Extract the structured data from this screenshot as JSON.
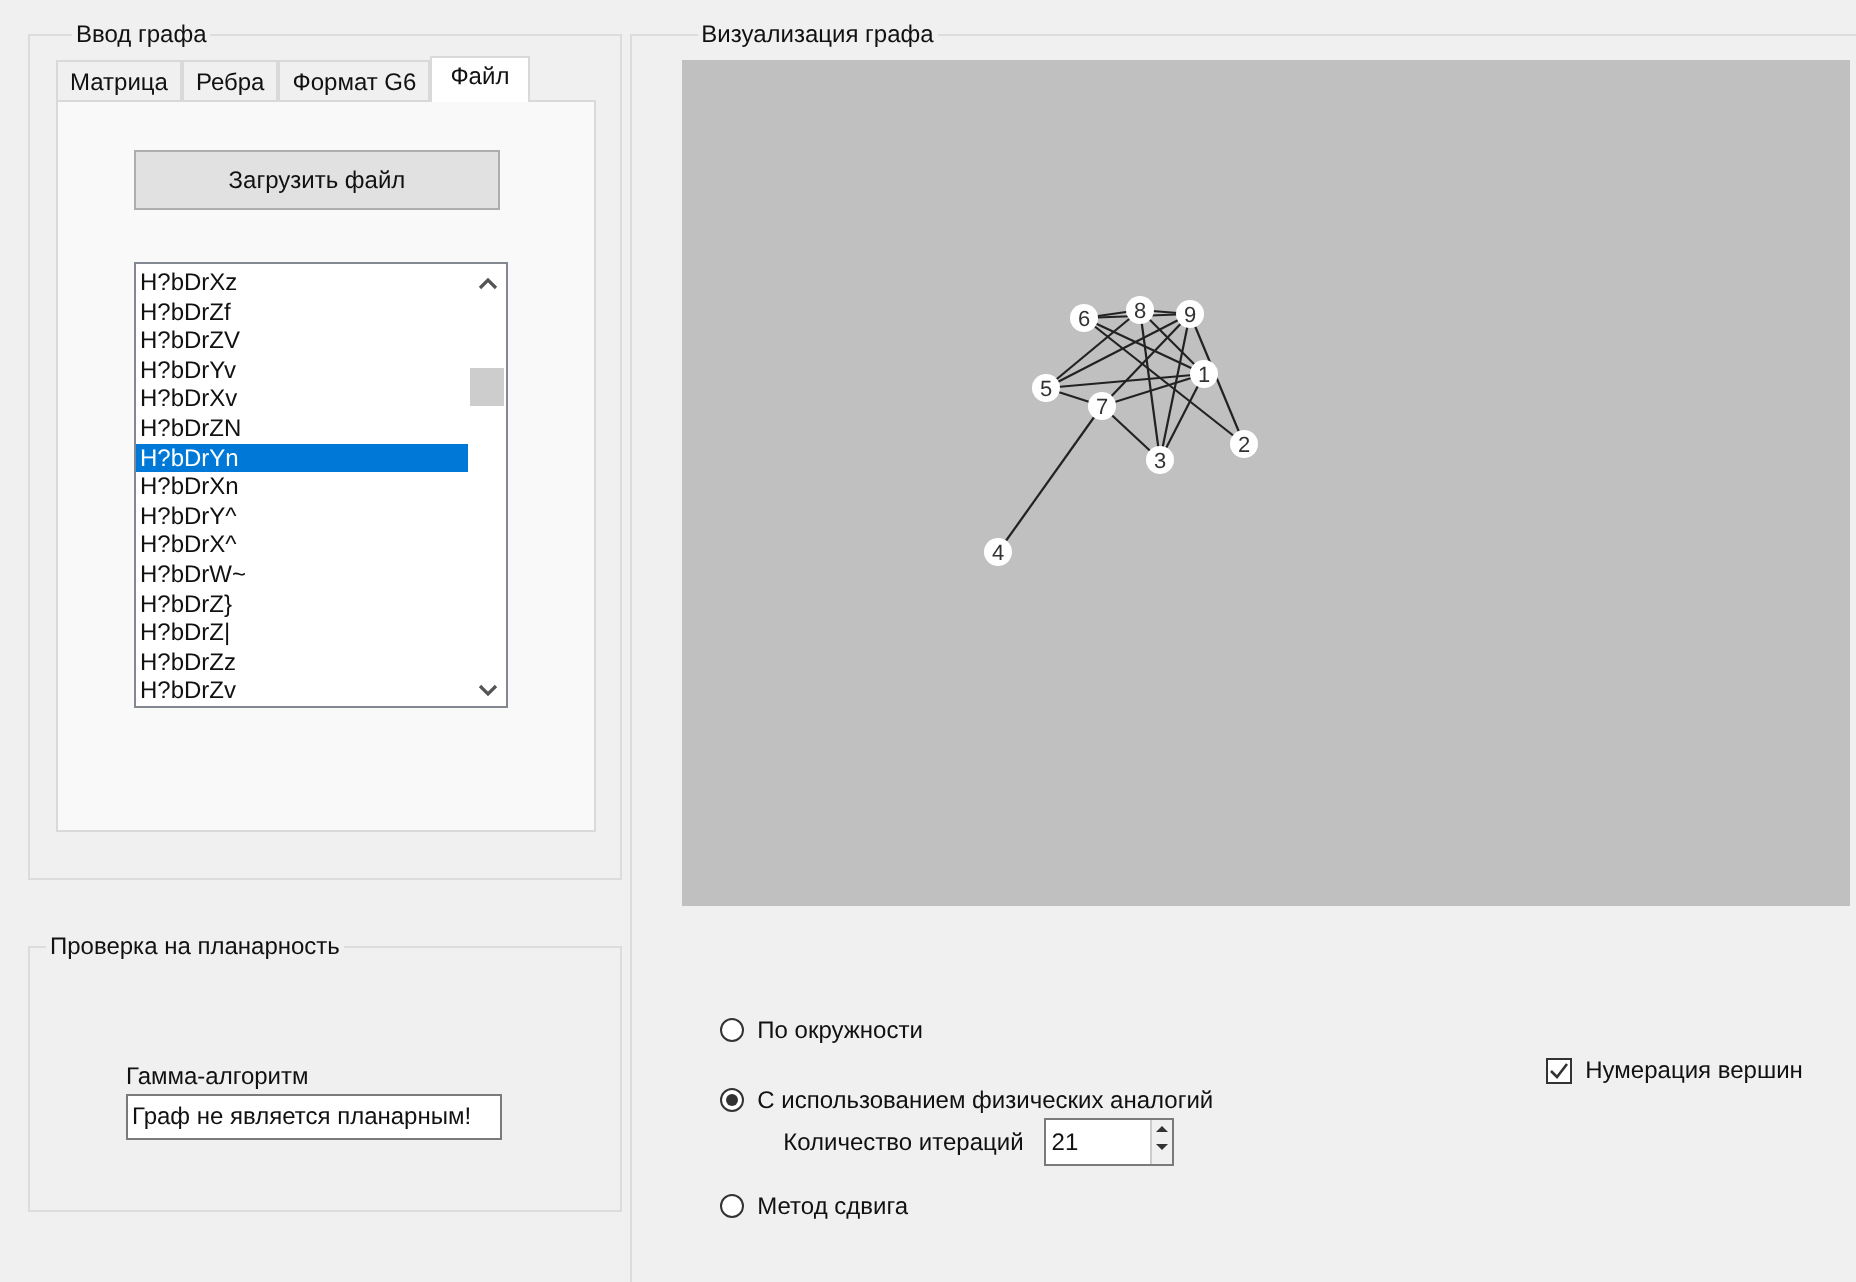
{
  "input_group": {
    "title": "Ввод графа",
    "tabs": [
      {
        "label": "Матрица",
        "selected": false
      },
      {
        "label": "Ребра",
        "selected": false
      },
      {
        "label": "Формат G6",
        "selected": false
      },
      {
        "label": "Файл",
        "selected": true
      }
    ],
    "load_button": "Загрузить файл",
    "file_list": [
      {
        "label": "H?bDrXz",
        "selected": false
      },
      {
        "label": "H?bDrZf",
        "selected": false
      },
      {
        "label": "H?bDrZV",
        "selected": false
      },
      {
        "label": "H?bDrYv",
        "selected": false
      },
      {
        "label": "H?bDrXv",
        "selected": false
      },
      {
        "label": "H?bDrZN",
        "selected": false
      },
      {
        "label": "H?bDrYn",
        "selected": true
      },
      {
        "label": "H?bDrXn",
        "selected": false
      },
      {
        "label": "H?bDrY^",
        "selected": false
      },
      {
        "label": "H?bDrX^",
        "selected": false
      },
      {
        "label": "H?bDrW~",
        "selected": false
      },
      {
        "label": "H?bDrZ}",
        "selected": false
      },
      {
        "label": "H?bDrZ|",
        "selected": false
      },
      {
        "label": "H?bDrZz",
        "selected": false
      },
      {
        "label": "H?bDrZv",
        "selected": false
      }
    ]
  },
  "planarity_group": {
    "title": "Проверка на планарность",
    "label": "Гамма-алгоритм",
    "result": "Граф не является планарным!"
  },
  "visualization_group": {
    "title": "Визуализация графа",
    "graph": {
      "nodes": [
        {
          "label": "1"
        },
        {
          "label": "2"
        },
        {
          "label": "3"
        },
        {
          "label": "4"
        },
        {
          "label": "5"
        },
        {
          "label": "6"
        },
        {
          "label": "7"
        },
        {
          "label": "8"
        },
        {
          "label": "9"
        }
      ]
    },
    "layout_options": [
      {
        "label": "По окружности",
        "selected": false
      },
      {
        "label": "С использованием физических аналогий",
        "selected": true
      },
      {
        "label": "Метод сдвига",
        "selected": false
      }
    ],
    "iterations_label": "Количество итераций",
    "iterations": "21",
    "vertex_numbering": {
      "label": "Нумерация вершин",
      "checked": true
    }
  }
}
